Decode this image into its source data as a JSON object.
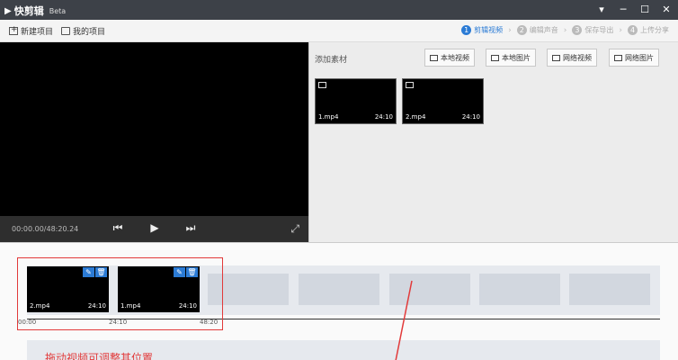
{
  "app": {
    "name": "快剪辑",
    "badge": "Beta",
    "window_controls": [
      "minimize-icon",
      "restore-icon",
      "close-icon"
    ]
  },
  "toolbar": {
    "new_project": "新建项目",
    "my_projects": "我的项目",
    "steps": [
      {
        "num": "1",
        "label": "剪辑视频",
        "active": true
      },
      {
        "num": "2",
        "label": "编辑声音",
        "active": false
      },
      {
        "num": "3",
        "label": "保存导出",
        "active": false
      },
      {
        "num": "4",
        "label": "上传分享",
        "active": false
      }
    ]
  },
  "player": {
    "timecode": "00:00.00/48:20.24"
  },
  "library": {
    "title": "添加素材",
    "buttons": [
      "本地视频",
      "本地图片",
      "网络视频",
      "网络图片"
    ],
    "clips": [
      {
        "name": "1.mp4",
        "duration": "24:10"
      },
      {
        "name": "2.mp4",
        "duration": "24:10"
      }
    ]
  },
  "timeline": {
    "clips": [
      {
        "name": "2.mp4",
        "duration": "24:10"
      },
      {
        "name": "1.mp4",
        "duration": "24:10"
      }
    ],
    "ruler": [
      "00:00",
      "24:10",
      "48:20"
    ],
    "hint": "拖动视频可调整其位置"
  },
  "colors": {
    "accent": "#2b7bd5",
    "annotation": "#e23a3a",
    "titlebar": "#3d4148"
  }
}
